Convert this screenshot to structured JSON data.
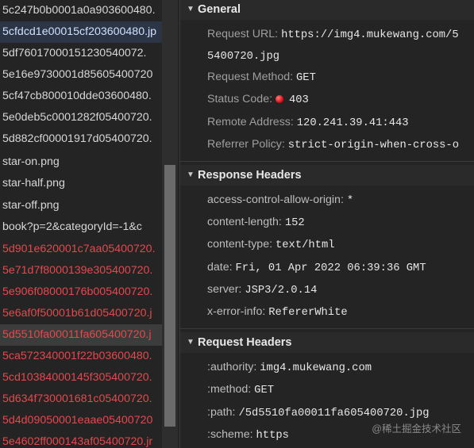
{
  "requests": [
    {
      "name": "5c247b0b0001a0a903600480.",
      "state": "normal"
    },
    {
      "name": "5cfdcd1e00015cf203600480.jp",
      "state": "hover"
    },
    {
      "name": "5df76017000151230540072.",
      "state": "normal"
    },
    {
      "name": "5e16e9730001d85605400720",
      "state": "normal"
    },
    {
      "name": "5cf47cb800010dde03600480.",
      "state": "normal"
    },
    {
      "name": "5e0deb5c0001282f05400720.",
      "state": "normal"
    },
    {
      "name": "5d882cf00001917d05400720.",
      "state": "normal"
    },
    {
      "name": "star-on.png",
      "state": "normal"
    },
    {
      "name": "star-half.png",
      "state": "normal"
    },
    {
      "name": "star-off.png",
      "state": "normal"
    },
    {
      "name": "book?p=2&categoryId=-1&c",
      "state": "normal"
    },
    {
      "name": "5d901e620001c7aa05400720.",
      "state": "error"
    },
    {
      "name": "5e71d7f8000139e305400720.",
      "state": "error"
    },
    {
      "name": "5e906f08000176b005400720.",
      "state": "error"
    },
    {
      "name": "5e6af0f50001b61d05400720.j",
      "state": "error"
    },
    {
      "name": "5d5510fa00011fa605400720.j",
      "state": "error-selected"
    },
    {
      "name": "5ca572340001f22b03600480.",
      "state": "error"
    },
    {
      "name": "5cd10384000145f305400720.",
      "state": "error"
    },
    {
      "name": "5d634f730001681c05400720.",
      "state": "error"
    },
    {
      "name": "5d4d09050001eaae05400720",
      "state": "error"
    },
    {
      "name": "5e4602ff000143af05400720.jr",
      "state": "error"
    }
  ],
  "general": {
    "title": "General",
    "request_url_label": "Request URL:",
    "request_url_value": "https://img4.mukewang.com/5",
    "request_url_cont": "5400720.jpg",
    "request_method_label": "Request Method:",
    "request_method_value": "GET",
    "status_code_label": "Status Code:",
    "status_code_value": "403",
    "remote_address_label": "Remote Address:",
    "remote_address_value": "120.241.39.41:443",
    "referrer_policy_label": "Referrer Policy:",
    "referrer_policy_value": "strict-origin-when-cross-o"
  },
  "response_headers": {
    "title": "Response Headers",
    "items": [
      {
        "k": "access-control-allow-origin:",
        "v": "*"
      },
      {
        "k": "content-length:",
        "v": "152"
      },
      {
        "k": "content-type:",
        "v": "text/html"
      },
      {
        "k": "date:",
        "v": "Fri, 01 Apr 2022 06:39:36 GMT"
      },
      {
        "k": "server:",
        "v": "JSP3/2.0.14"
      },
      {
        "k": "x-error-info:",
        "v": "RefererWhite"
      }
    ]
  },
  "request_headers": {
    "title": "Request Headers",
    "items": [
      {
        "k": ":authority:",
        "v": "img4.mukewang.com"
      },
      {
        "k": ":method:",
        "v": "GET"
      },
      {
        "k": ":path:",
        "v": "/5d5510fa00011fa605400720.jpg"
      },
      {
        "k": ":scheme:",
        "v": "https"
      }
    ]
  },
  "watermark": "@稀土掘金技术社区",
  "colors": {
    "error_text": "#e5484d",
    "status_dot": "#e0101a"
  }
}
